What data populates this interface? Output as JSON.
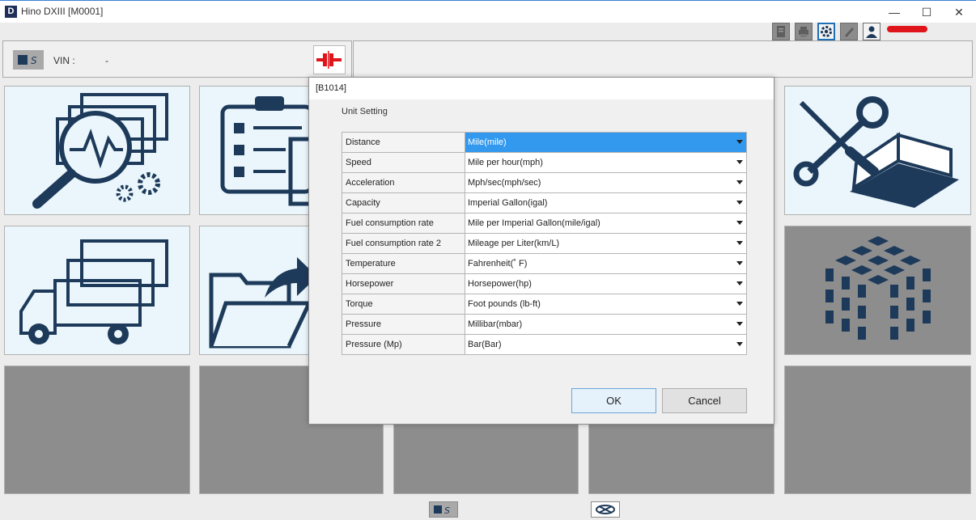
{
  "window": {
    "app_icon_letter": "D",
    "title": "Hino DXIII [M0001]",
    "minimize": "—",
    "maximize": "☐",
    "close": "✕"
  },
  "header": {
    "vin_label": "VIN :",
    "vin_value": "-"
  },
  "toolbar": {
    "icons": [
      "report-icon",
      "print-icon",
      "gear-icon",
      "edit-icon",
      "user-icon"
    ]
  },
  "dialog": {
    "title": "[B1014]",
    "section_title": "Unit Setting",
    "rows": [
      {
        "label": "Distance",
        "value": "Mile(mile)"
      },
      {
        "label": "Speed",
        "value": "Mile per hour(mph)"
      },
      {
        "label": "Acceleration",
        "value": "Mph/sec(mph/sec)"
      },
      {
        "label": "Capacity",
        "value": "Imperial Gallon(igal)"
      },
      {
        "label": "Fuel consumption rate",
        "value": "Mile per Imperial Gallon(mile/igal)"
      },
      {
        "label": "Fuel consumption rate 2",
        "value": "Mileage per Liter(km/L)"
      },
      {
        "label": "Temperature",
        "value": "Fahrenheit(˚ F)"
      },
      {
        "label": "Horsepower",
        "value": "Horsepower(hp)"
      },
      {
        "label": "Torque",
        "value": "Foot pounds (lb-ft)"
      },
      {
        "label": "Pressure",
        "value": "Millibar(mbar)"
      },
      {
        "label": "Pressure (Mp)",
        "value": "Bar(Bar)"
      }
    ],
    "ok_label": "OK",
    "cancel_label": "Cancel"
  },
  "colors": {
    "accent": "#3399ee",
    "icon_navy": "#1e3a5a",
    "tile_light": "#eaf6fb",
    "tile_gray": "#8d8d8d",
    "connect_red": "#e0141b"
  }
}
